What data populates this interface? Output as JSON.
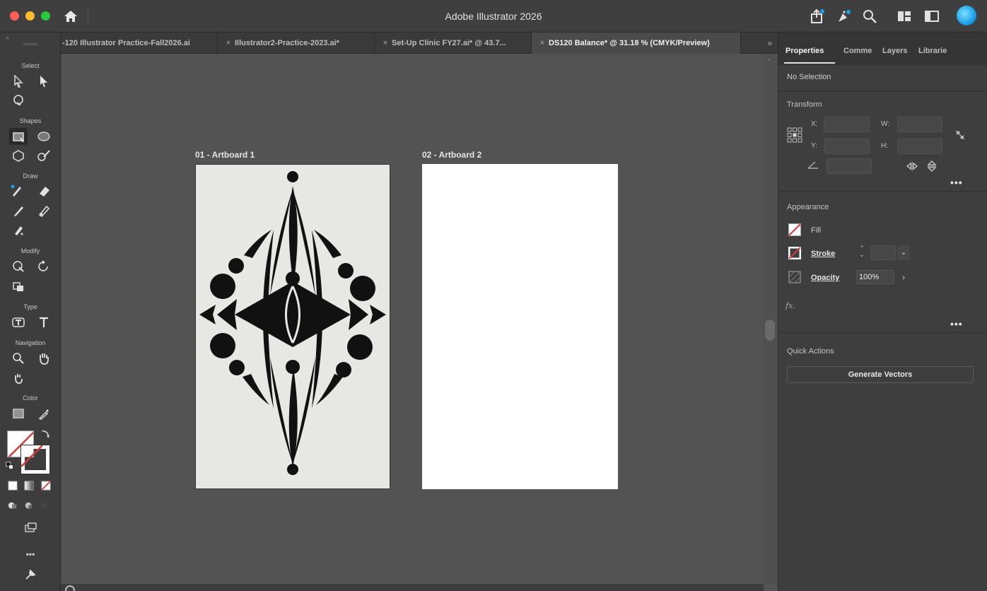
{
  "app": {
    "title": "Adobe Illustrator 2026"
  },
  "colors": {
    "accent": "#1aa0e8",
    "ui_dark": "#3e3e3e",
    "canvas": "#535353",
    "none_slash": "#d33a3a"
  },
  "tabs": [
    {
      "label": "-120 Illustrator Practice-Fall2026.ai",
      "active": false
    },
    {
      "label": "Illustrator2-Practice-2023.ai*",
      "active": false
    },
    {
      "label": "Set-Up Clinic FY27.ai* @ 43.7...",
      "active": false
    },
    {
      "label": "DS120 Balance* @ 31.18 % (CMYK/Preview)",
      "active": true
    }
  ],
  "tools": {
    "sections": {
      "select": "Select",
      "shapes": "Shapes",
      "draw": "Draw",
      "modify": "Modify",
      "type": "Type",
      "navigation": "Navigation",
      "color": "Color"
    },
    "more": "•••"
  },
  "canvas": {
    "artboard1": "01 - Artboard 1",
    "artboard2": "02 - Artboard 2"
  },
  "panel": {
    "tabs": [
      "Properties",
      "Comme",
      "Layers",
      "Librarie"
    ],
    "no_selection": "No Selection",
    "transform": {
      "heading": "Transform",
      "x_label": "X:",
      "y_label": "Y:",
      "w_label": "W:",
      "h_label": "H:"
    },
    "appearance": {
      "heading": "Appearance",
      "fill": "Fill",
      "stroke": "Stroke",
      "opacity": "Opacity",
      "opacity_value": "100%",
      "fx": "fx."
    },
    "quick_actions": {
      "heading": "Quick Actions",
      "generate": "Generate Vectors"
    },
    "ellipsis": "•••"
  },
  "status": {
    "text": ""
  }
}
